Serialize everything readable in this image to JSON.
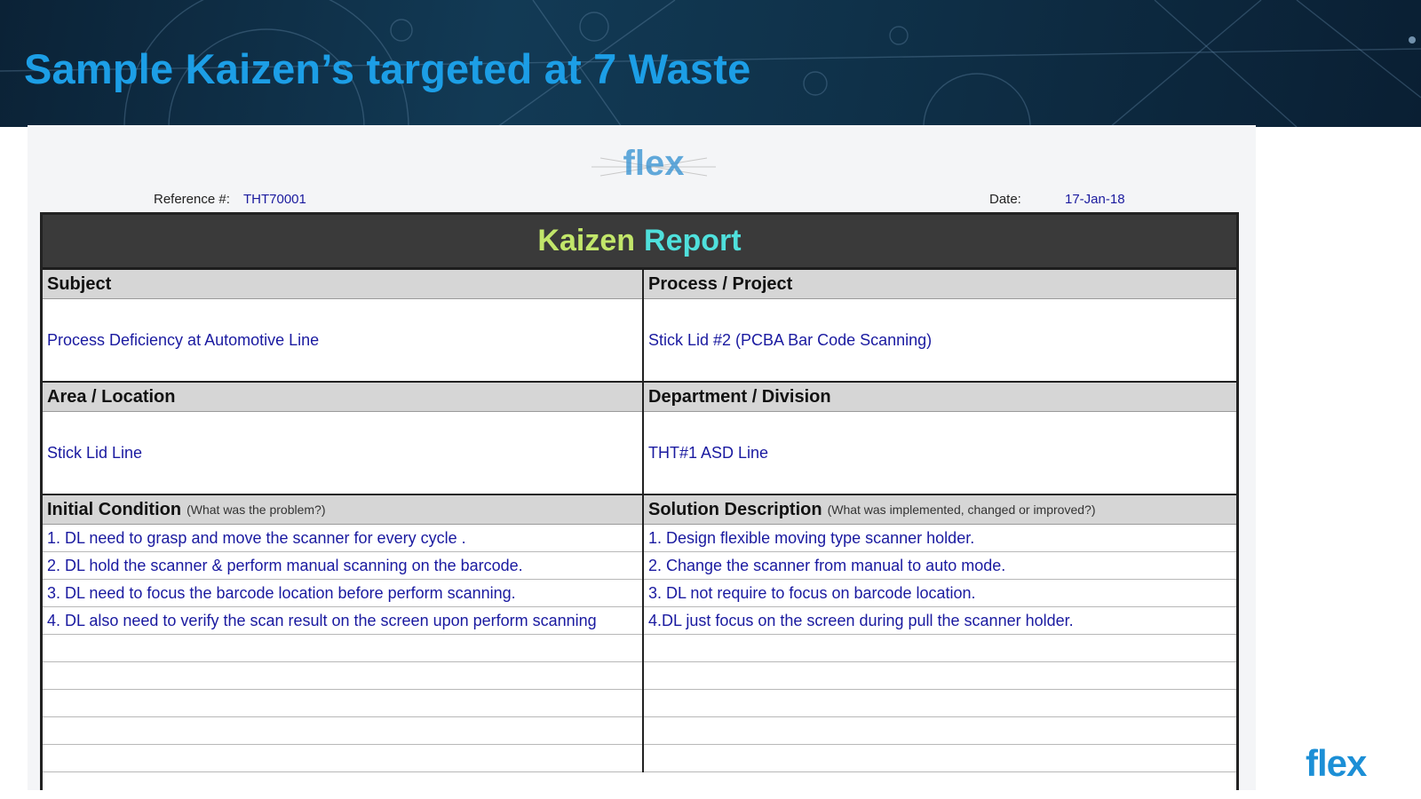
{
  "slide": {
    "title": "Sample Kaizen’s targeted at 7 Waste",
    "brand_logo": "flex",
    "accent_color": "#1c9ee6"
  },
  "sheet": {
    "logo_text": "flex",
    "reference_label": "Reference #:",
    "reference_value": "THT70001",
    "date_label": "Date:",
    "date_value": "17-Jan-18"
  },
  "report": {
    "title_word1": "Kaizen",
    "title_word2": "Report",
    "subject_label": "Subject",
    "subject_value": "Process Deficiency at Automotive Line",
    "process_label": "Process / Project",
    "process_value": "Stick Lid #2 (PCBA Bar Code Scanning)",
    "area_label": "Area / Location",
    "area_value": "Stick Lid Line",
    "department_label": "Department / Division",
    "department_value": "THT#1 ASD Line",
    "initial_label": "Initial Condition",
    "initial_hint": "(What was the problem?)",
    "solution_label": "Solution Description",
    "solution_hint": "(What was implemented, changed or improved?)",
    "rows": [
      {
        "initial": "1. DL need to grasp and move the scanner for every cycle .",
        "solution": "1. Design flexible moving type scanner holder."
      },
      {
        "initial": "2. DL hold the scanner & perform manual scanning on the barcode.",
        "solution": "2. Change the scanner from manual to auto mode."
      },
      {
        "initial": "3. DL need to focus the barcode location before perform scanning.",
        "solution": "3. DL not require to focus on barcode location."
      },
      {
        "initial": "4. DL also need to verify the scan result on the screen upon perform scanning",
        "solution": "4.DL just focus on the screen during pull the scanner holder."
      },
      {
        "initial": "",
        "solution": ""
      },
      {
        "initial": "",
        "solution": ""
      },
      {
        "initial": "",
        "solution": ""
      },
      {
        "initial": "",
        "solution": ""
      },
      {
        "initial": "",
        "solution": ""
      }
    ]
  }
}
